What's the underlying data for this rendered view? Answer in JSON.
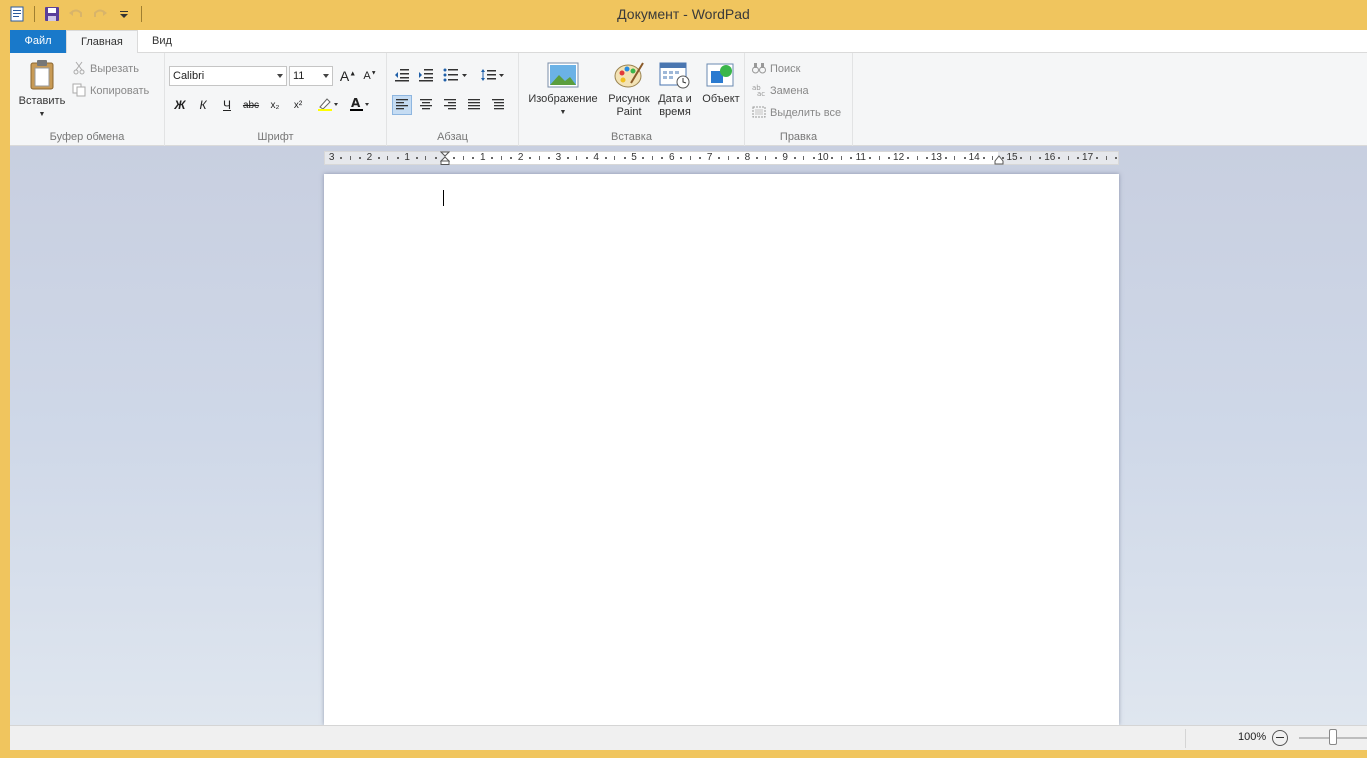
{
  "window": {
    "title": "Документ - WordPad"
  },
  "qat": {
    "icons": [
      "wordpad-app-icon",
      "save-icon",
      "undo-icon",
      "redo-icon",
      "customize-dropdown-icon"
    ]
  },
  "tabs": [
    {
      "label": "Файл"
    },
    {
      "label": "Главная"
    },
    {
      "label": "Вид"
    }
  ],
  "ribbon": {
    "clipboard": {
      "label": "Буфер обмена",
      "paste": "Вставить",
      "cut": "Вырезать",
      "copy": "Копировать"
    },
    "font": {
      "label": "Шрифт",
      "family": "Calibri",
      "size": "11",
      "bold": "Ж",
      "italic": "К",
      "underline": "Ч",
      "strike": "abc",
      "sub": "x₂",
      "sup": "x²"
    },
    "paragraph": {
      "label": "Абзац"
    },
    "insert": {
      "label": "Вставка",
      "picture": "Изображение",
      "paint_line1": "Рисунок",
      "paint_line2": "Paint",
      "datetime_line1": "Дата и",
      "datetime_line2": "время",
      "object": "Объект"
    },
    "editing": {
      "label": "Правка",
      "find": "Поиск",
      "replace": "Замена",
      "select_all": "Выделить все"
    }
  },
  "ruler": {
    "labels": [
      "3",
      "2",
      "1",
      "1",
      "2",
      "3",
      "4",
      "5",
      "6",
      "7",
      "8",
      "9",
      "10",
      "11",
      "12",
      "13",
      "14",
      "15",
      "16",
      "17"
    ]
  },
  "status": {
    "zoom": "100%",
    "zoom_level": 0.5
  },
  "colors": {
    "title_bar": "#f0c55e",
    "file_tab": "#1979ca",
    "ribbon_bg": "#f5f6f7"
  }
}
